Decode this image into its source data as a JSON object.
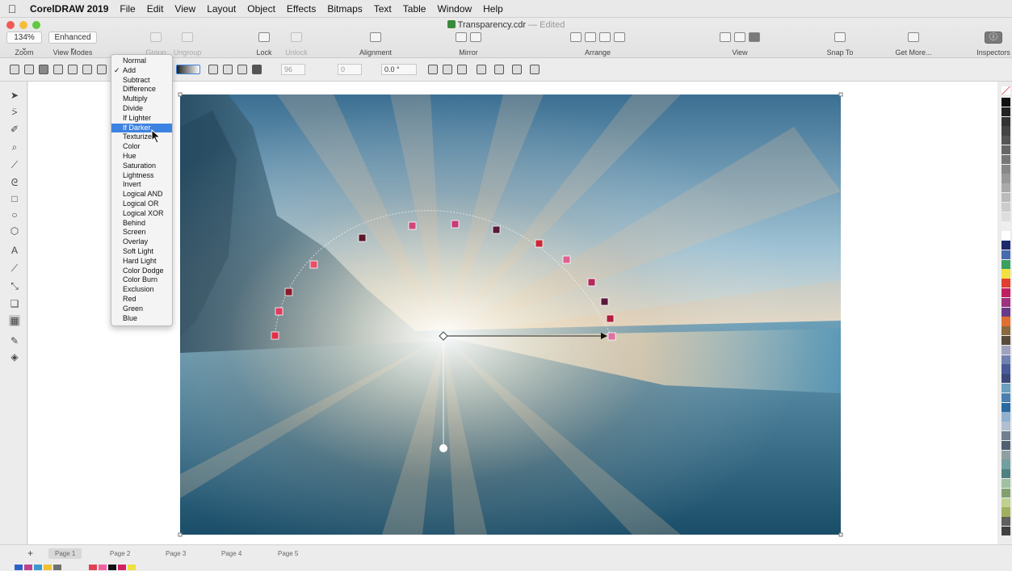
{
  "menubar": {
    "app_name": "CorelDRAW 2019",
    "items": [
      "File",
      "Edit",
      "View",
      "Layout",
      "Object",
      "Effects",
      "Bitmaps",
      "Text",
      "Table",
      "Window",
      "Help"
    ]
  },
  "window": {
    "title": "Transparency.cdr",
    "status": "— Edited"
  },
  "toolbar": {
    "zoom_value": "134% ⌄",
    "zoom_label": "Zoom",
    "view_mode_value": "Enhanced ⌄",
    "view_mode_label": "View Modes",
    "group_label": "Group",
    "ungroup_label": "Ungroup",
    "lock_label": "Lock",
    "unlock_label": "Unlock",
    "alignment_label": "Alignment",
    "mirror_label": "Mirror",
    "arrange_label": "Arrange",
    "view_label": "View",
    "snap_label": "Snap To",
    "get_more_label": "Get More...",
    "inspectors_label": "Inspectors"
  },
  "propbar": {
    "field_1": "96",
    "field_2": "0",
    "angle": "0.0 °"
  },
  "blend_menu": {
    "items": [
      {
        "label": "Normal"
      },
      {
        "label": "Add",
        "checked": true
      },
      {
        "label": "Subtract"
      },
      {
        "label": "Difference"
      },
      {
        "label": "Multiply"
      },
      {
        "label": "Divide"
      },
      {
        "label": "If Lighter"
      },
      {
        "label": "If Darker",
        "highlighted": true
      },
      {
        "label": "Texturize"
      },
      {
        "label": "Color"
      },
      {
        "label": "Hue"
      },
      {
        "label": "Saturation"
      },
      {
        "label": "Lightness"
      },
      {
        "label": "Invert"
      },
      {
        "label": "Logical AND"
      },
      {
        "label": "Logical OR"
      },
      {
        "label": "Logical XOR"
      },
      {
        "label": "Behind"
      },
      {
        "label": "Screen"
      },
      {
        "label": "Overlay"
      },
      {
        "label": "Soft Light"
      },
      {
        "label": "Hard Light"
      },
      {
        "label": "Color Dodge"
      },
      {
        "label": "Color Burn"
      },
      {
        "label": "Exclusion"
      },
      {
        "label": "Red"
      },
      {
        "label": "Green"
      },
      {
        "label": "Blue"
      }
    ],
    "checkmark": "✓"
  },
  "pages": {
    "add": "+",
    "tabs": [
      "Page 1",
      "Page 2",
      "Page 3",
      "Page 4",
      "Page 5"
    ],
    "active": 0
  },
  "colors": {
    "accent": "#3d82e0",
    "fountain_nodes": [
      "#e0304a",
      "#e03a60",
      "#8b1a2a",
      "#e8506a",
      "#5a1828",
      "#d0487a",
      "#c83a78",
      "#5a1a3a",
      "#c82838",
      "#e06090",
      "#b02a5a",
      "#5a1a3a",
      "#b02040",
      "#e070a0"
    ]
  },
  "palette_colors": [
    "#111111",
    "#222222",
    "#333333",
    "#444444",
    "#555555",
    "#666666",
    "#777777",
    "#888888",
    "#999999",
    "#aaaaaa",
    "#bbbbbb",
    "#cccccc",
    "#dddddd",
    "#eeeeee",
    "#ffffff",
    "#1a2a6a",
    "#4a6ab0",
    "#3aa060",
    "#f0e040",
    "#e04030",
    "#c02060",
    "#a03080",
    "#6a3a8a",
    "#e07030",
    "#8a6a40",
    "#5a4a3a",
    "#a0a0c0",
    "#7080b0",
    "#4a5a9a",
    "#3a4a7a",
    "#6aa0c0",
    "#4a80b0",
    "#2a6aa0",
    "#90b0d0",
    "#b0c0d0",
    "#708090",
    "#506070",
    "#90a0a0",
    "#70a0a0",
    "#508080",
    "#a0c0a0",
    "#80a070",
    "#c0d090",
    "#a0b060",
    "#606060",
    "#404040"
  ],
  "bottom_colors": [
    "#2c62c8",
    "#c04090",
    "#3a9ad0",
    "#f0c030",
    "#707070",
    "#e04050",
    "#f060a0",
    "#111111",
    "#d02060",
    "#f0e040"
  ]
}
